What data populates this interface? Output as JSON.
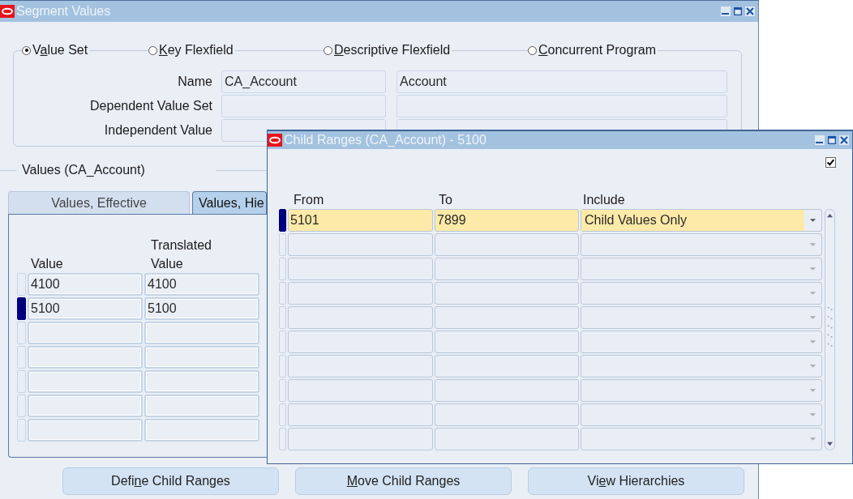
{
  "main_window": {
    "title": "Segment Values",
    "source_options": [
      {
        "label_before": "V",
        "mnemonic": "a",
        "label_after": "lue Set",
        "selected": true
      },
      {
        "mnemonic": "K",
        "label_after": "ey Flexfield",
        "selected": false
      },
      {
        "mnemonic": "D",
        "label_after": "escriptive Flexfield",
        "selected": false
      },
      {
        "mnemonic": "C",
        "label_after": "oncurrent Program",
        "selected": false
      }
    ],
    "fields": [
      {
        "label": "Name",
        "value": "CA_Account",
        "description": "Account"
      },
      {
        "label": "Dependent Value Set"
      },
      {
        "label": "Independent Value"
      }
    ],
    "values_region": {
      "title": "Values (CA_Account)",
      "tabs": [
        {
          "label": "Values, Effective",
          "selected": false
        },
        {
          "label": "Values, Hie",
          "selected": true
        }
      ],
      "columns": [
        "Value",
        "Translated Value"
      ],
      "rows": [
        {
          "value": "4100",
          "translated_value": "4100",
          "current": false
        },
        {
          "value": "5100",
          "translated_value": "5100",
          "current": true
        },
        {
          "current": false
        },
        {
          "current": false
        },
        {
          "current": false
        },
        {
          "current": false
        },
        {
          "current": false
        }
      ]
    },
    "buttons": [
      {
        "label_before": "Defi",
        "mnemonic": "n",
        "label_after": "e Child Ranges"
      },
      {
        "mnemonic": "M",
        "label_after": "ove Child Ranges"
      },
      {
        "label_before": "Vi",
        "mnemonic": "e",
        "label_after": "w Hierarchies"
      }
    ]
  },
  "child_window": {
    "title": "Child Ranges (CA_Account) - 5100",
    "checkbox": {
      "checked": true
    },
    "columns": [
      "From",
      "To",
      "Include"
    ],
    "rows": [
      {
        "from": "5101",
        "to": "7899",
        "include": "Child Values Only",
        "current": true
      },
      {
        "current": false
      },
      {
        "current": false
      },
      {
        "current": false
      },
      {
        "current": false
      },
      {
        "current": false
      },
      {
        "current": false
      },
      {
        "current": false
      },
      {
        "current": false
      },
      {
        "current": false
      }
    ]
  }
}
